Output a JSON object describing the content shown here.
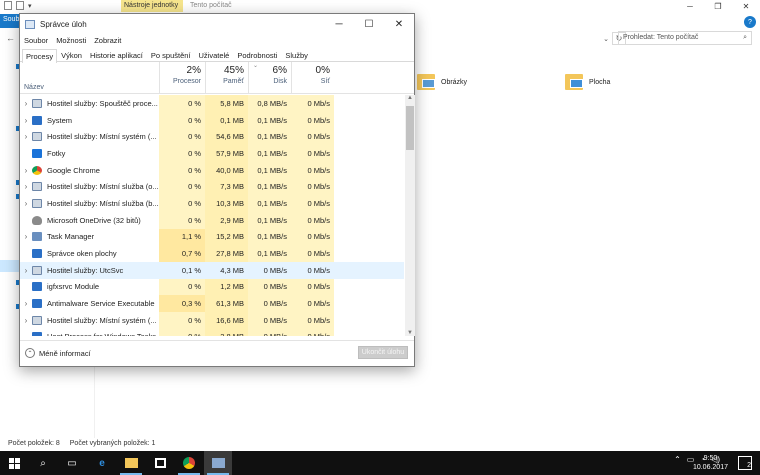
{
  "explorer": {
    "file_tab": "Soub",
    "tools_tab": "Nástroje jednotky",
    "tools_title": "Tento počítač",
    "search_placeholder": "Prohledat: Tento počítač",
    "folders": [
      {
        "name": "Obrázky"
      },
      {
        "name": "Plocha"
      }
    ],
    "status_items": "Počet položek: 8",
    "status_selected": "Počet vybraných položek: 1",
    "help": "?"
  },
  "taskmanager": {
    "title": "Správce úloh",
    "menu": [
      "Soubor",
      "Možnosti",
      "Zobrazit"
    ],
    "tabs": [
      "Procesy",
      "Výkon",
      "Historie aplikací",
      "Po spuštění",
      "Uživatelé",
      "Podrobnosti",
      "Služby"
    ],
    "columns": {
      "name": "Název",
      "cpu": {
        "pct": "2%",
        "label": "Procesor"
      },
      "mem": {
        "pct": "45%",
        "label": "Paměť"
      },
      "disk": {
        "pct": "6%",
        "label": "Disk"
      },
      "net": {
        "pct": "0%",
        "label": "Síť"
      }
    },
    "rows": [
      {
        "name": "Hostitel služby: Spouštěč proce...",
        "icon": "gear",
        "exp": true,
        "cpu": "0 %",
        "mem": "5,8 MB",
        "disk": "0,8 MB/s",
        "net": "0 Mb/s"
      },
      {
        "name": "System",
        "icon": "win",
        "exp": true,
        "cpu": "0 %",
        "mem": "0,1 MB",
        "disk": "0,1 MB/s",
        "net": "0 Mb/s"
      },
      {
        "name": "Hostitel služby: Místní systém (...",
        "icon": "gear",
        "exp": true,
        "cpu": "0 %",
        "mem": "54,6 MB",
        "disk": "0,1 MB/s",
        "net": "0 Mb/s"
      },
      {
        "name": "Fotky",
        "icon": "photo",
        "exp": false,
        "cpu": "0 %",
        "mem": "57,9 MB",
        "disk": "0,1 MB/s",
        "net": "0 Mb/s"
      },
      {
        "name": "Google Chrome",
        "icon": "chrome",
        "exp": true,
        "cpu": "0 %",
        "mem": "40,0 MB",
        "disk": "0,1 MB/s",
        "net": "0 Mb/s"
      },
      {
        "name": "Hostitel služby: Místní služba (o...",
        "icon": "gear",
        "exp": true,
        "cpu": "0 %",
        "mem": "7,3 MB",
        "disk": "0,1 MB/s",
        "net": "0 Mb/s"
      },
      {
        "name": "Hostitel služby: Místní služba (b...",
        "icon": "gear",
        "exp": true,
        "cpu": "0 %",
        "mem": "10,3 MB",
        "disk": "0,1 MB/s",
        "net": "0 Mb/s"
      },
      {
        "name": "Microsoft OneDrive (32 bitů)",
        "icon": "cloud",
        "exp": false,
        "cpu": "0 %",
        "mem": "2,9 MB",
        "disk": "0,1 MB/s",
        "net": "0 Mb/s"
      },
      {
        "name": "Task Manager",
        "icon": "tm",
        "exp": true,
        "cpu": "1,1 %",
        "mem": "15,2 MB",
        "disk": "0,1 MB/s",
        "net": "0 Mb/s"
      },
      {
        "name": "Správce oken plochy",
        "icon": "win",
        "exp": false,
        "cpu": "0,7 %",
        "mem": "27,8 MB",
        "disk": "0,1 MB/s",
        "net": "0 Mb/s"
      },
      {
        "name": "Hostitel služby: UtcSvc",
        "icon": "gear",
        "exp": true,
        "selected": true,
        "cpu": "0,1 %",
        "mem": "4,3 MB",
        "disk": "0 MB/s",
        "net": "0 Mb/s"
      },
      {
        "name": "igfxsrvc Module",
        "icon": "win",
        "exp": false,
        "cpu": "0 %",
        "mem": "1,2 MB",
        "disk": "0 MB/s",
        "net": "0 Mb/s"
      },
      {
        "name": "Antimalware Service Executable",
        "icon": "win",
        "exp": true,
        "cpu": "0,3 %",
        "mem": "61,3 MB",
        "disk": "0 MB/s",
        "net": "0 Mb/s"
      },
      {
        "name": "Hostitel služby: Místní systém (...",
        "icon": "gear",
        "exp": true,
        "cpu": "0 %",
        "mem": "16,6 MB",
        "disk": "0 MB/s",
        "net": "0 Mb/s"
      },
      {
        "name": "Host Process for Windows Tasks",
        "icon": "win",
        "exp": false,
        "cpu": "0 %",
        "mem": "2,8 MB",
        "disk": "0 MB/s",
        "net": "0 Mb/s"
      }
    ],
    "less_info": "Méně informací",
    "end_task": "Ukončit úlohu"
  },
  "taskbar": {
    "time": "9:50",
    "date": "10.06.2017",
    "notif_count": "2"
  }
}
